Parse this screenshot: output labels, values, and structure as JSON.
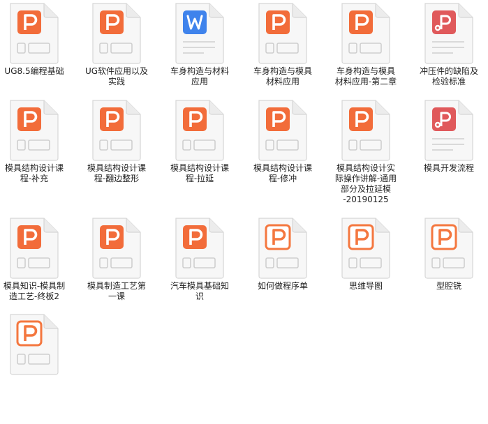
{
  "colors": {
    "ppt": "#f26c3a",
    "ppt_light": "#f4773f",
    "word": "#3f83ec",
    "pdf": "#e0595b",
    "doc_body": "#f7f7f7",
    "doc_border": "#d6d6d6",
    "detail": "#cfcfcf"
  },
  "files": [
    {
      "label": "UG8.5编程基础",
      "icon": "ppt-icon",
      "type": "ppt"
    },
    {
      "label": "UG软件应用以及\n实践",
      "icon": "ppt-icon",
      "type": "ppt"
    },
    {
      "label": "车身构造与材料\n应用",
      "icon": "word-icon",
      "type": "word"
    },
    {
      "label": "车身构造与模具\n材料应用",
      "icon": "ppt-icon",
      "type": "ppt"
    },
    {
      "label": "车身构造与模具\n材料应用-第二章",
      "icon": "ppt-icon",
      "type": "ppt"
    },
    {
      "label": "冲压件的缺陷及\n检验标准",
      "icon": "pdf-icon",
      "type": "pdf"
    },
    {
      "label": "模具结构设计课\n程-补充",
      "icon": "ppt-icon",
      "type": "ppt"
    },
    {
      "label": "模具结构设计课\n程-翻边整形",
      "icon": "ppt-icon",
      "type": "ppt"
    },
    {
      "label": "模具结构设计课\n程-拉延",
      "icon": "ppt-icon",
      "type": "ppt"
    },
    {
      "label": "模具结构设计课\n程-修冲",
      "icon": "ppt-icon",
      "type": "ppt"
    },
    {
      "label": "模具结构设计实\n际操作讲解-通用\n部分及拉延模\n-20190125",
      "icon": "ppt-icon",
      "type": "ppt"
    },
    {
      "label": "模具开发流程",
      "icon": "pdf-icon",
      "type": "pdf"
    },
    {
      "label": "模具知识-模具制\n造工艺-终板2",
      "icon": "ppt-icon",
      "type": "ppt"
    },
    {
      "label": "模具制造工艺第\n一课",
      "icon": "ppt-icon",
      "type": "ppt"
    },
    {
      "label": "汽车模具基础知\n识",
      "icon": "ppt-icon",
      "type": "ppt"
    },
    {
      "label": "如何做程序单",
      "icon": "ppt-outline-icon",
      "type": "ppt_outline"
    },
    {
      "label": "思维导图",
      "icon": "ppt-outline-icon",
      "type": "ppt_outline"
    },
    {
      "label": "型腔铣",
      "icon": "ppt-outline-icon",
      "type": "ppt_outline"
    },
    {
      "label": "",
      "icon": "ppt-outline-icon",
      "type": "ppt_outline"
    }
  ]
}
